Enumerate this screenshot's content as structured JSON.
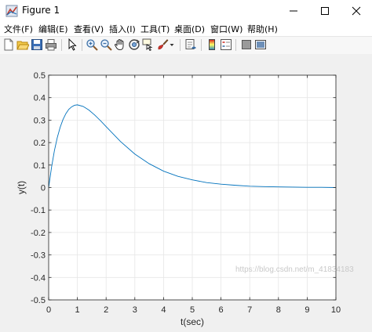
{
  "window": {
    "title": "Figure 1"
  },
  "menu": [
    {
      "label": "文件(F)"
    },
    {
      "label": "编辑(E)"
    },
    {
      "label": "查看(V)"
    },
    {
      "label": "插入(I)"
    },
    {
      "label": "工具(T)"
    },
    {
      "label": "桌面(D)"
    },
    {
      "label": "窗口(W)"
    },
    {
      "label": "帮助(H)"
    }
  ],
  "toolbar": {
    "icons": [
      "new-figure-icon",
      "open-file-icon",
      "save-icon",
      "print-icon",
      "edit-plot-arrow-icon",
      "zoom-in-icon",
      "zoom-out-icon",
      "pan-hand-icon",
      "rotate-3d-icon",
      "data-cursor-icon",
      "brush-icon",
      "brush-dropdown-icon",
      "link-plot-icon",
      "colorbar-icon",
      "legend-icon",
      "hide-plot-tools-icon",
      "show-plot-tools-icon"
    ]
  },
  "chart_data": {
    "type": "line",
    "title": "",
    "xlabel": "t(sec)",
    "ylabel": "y(t)",
    "xlim": [
      0,
      10
    ],
    "ylim": [
      -0.5,
      0.5
    ],
    "xticks": [
      "0",
      "1",
      "2",
      "3",
      "4",
      "5",
      "6",
      "7",
      "8",
      "9",
      "10"
    ],
    "yticks": [
      "-0.5",
      "-0.4",
      "-0.3",
      "-0.2",
      "-0.1",
      "0",
      "0.1",
      "0.2",
      "0.3",
      "0.4",
      "0.5"
    ],
    "grid": true,
    "line_color": "#0072BD",
    "series": [
      {
        "x": [
          0,
          0.1,
          0.2,
          0.3,
          0.4,
          0.5,
          0.6,
          0.7,
          0.8,
          0.9,
          1.0,
          1.2,
          1.4,
          1.6,
          1.8,
          2.0,
          2.5,
          3.0,
          3.5,
          4.0,
          4.5,
          5.0,
          5.5,
          6.0,
          6.5,
          7.0,
          7.5,
          8.0,
          8.5,
          9.0,
          9.5,
          10.0
        ],
        "y": [
          0,
          0.09,
          0.164,
          0.222,
          0.268,
          0.303,
          0.329,
          0.348,
          0.359,
          0.366,
          0.368,
          0.361,
          0.345,
          0.323,
          0.298,
          0.271,
          0.205,
          0.149,
          0.106,
          0.073,
          0.05,
          0.034,
          0.022,
          0.015,
          0.01,
          0.006,
          0.004,
          0.003,
          0.002,
          0.001,
          0.001,
          0.0
        ]
      }
    ]
  },
  "watermark": "https://blog.csdn.net/m_41834183"
}
